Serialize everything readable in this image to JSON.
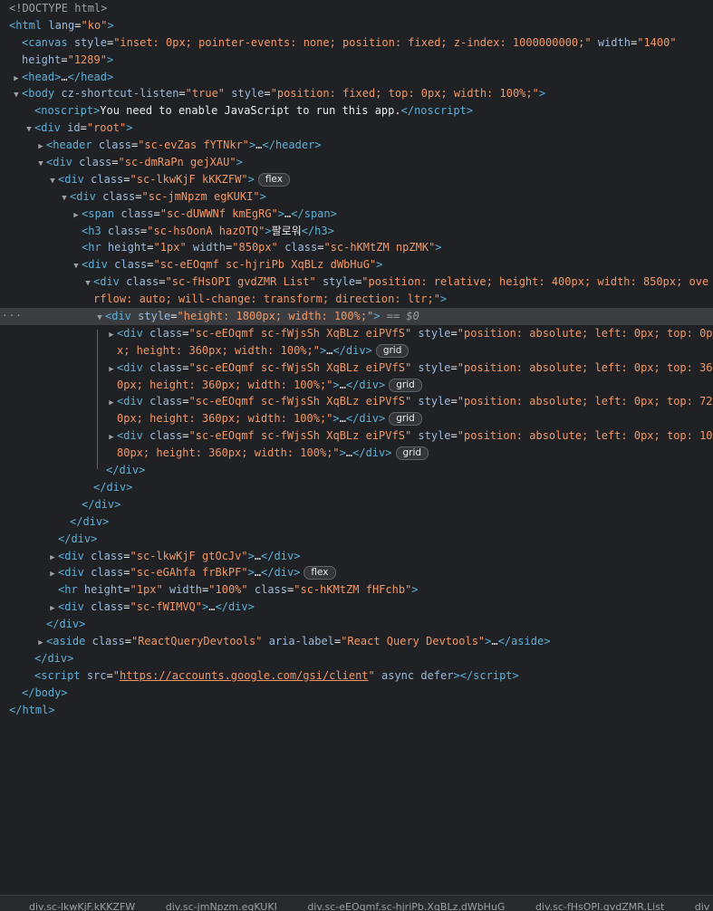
{
  "tree": {
    "l00": {
      "doctype": "<!DOCTYPE html>"
    },
    "l01": {
      "tag": "html",
      "attr": "lang",
      "val": "ko"
    },
    "l02": {
      "tag": "canvas",
      "a1": "style",
      "v1": "inset: 0px; pointer-events: none; position: fixed; z-index: 1000000000;",
      "a2": "width",
      "v2": "1400"
    },
    "l03": {
      "a1": "height",
      "v1": "1289"
    },
    "l04": {
      "tag": "head",
      "ell": "…"
    },
    "l05": {
      "tag": "body",
      "a1": "cz-shortcut-listen",
      "v1": "true",
      "a2": "style",
      "v2": "position: fixed; top: 0px; width: 100%;"
    },
    "l06": {
      "tag": "noscript",
      "text": "You need to enable JavaScript to run this app."
    },
    "l07": {
      "tag": "div",
      "a1": "id",
      "v1": "root"
    },
    "l08": {
      "tag": "header",
      "a1": "class",
      "v1": "sc-evZas fYTNkr",
      "ell": "…"
    },
    "l09": {
      "tag": "div",
      "a1": "class",
      "v1": "sc-dmRaPn gejXAU"
    },
    "l10": {
      "tag": "div",
      "a1": "class",
      "v1": "sc-lkwKjF kKKZFW",
      "badge": "flex"
    },
    "l11": {
      "tag": "div",
      "a1": "class",
      "v1": "sc-jmNpzm egKUKI"
    },
    "l12": {
      "tag": "span",
      "a1": "class",
      "v1": "sc-dUWWNf kmEgRG",
      "ell": "…"
    },
    "l13": {
      "tag": "h3",
      "a1": "class",
      "v1": "sc-hsOonA hazOTQ",
      "text": "팔로워"
    },
    "l14": {
      "tag": "hr",
      "a1": "height",
      "v1": "1px",
      "a2": "width",
      "v2": "850px",
      "a3": "class",
      "v3": "sc-hKMtZM npZMK"
    },
    "l15": {
      "tag": "div",
      "a1": "class",
      "v1": "sc-eEOqmf sc-hjriPb XqBLz dWbHuG"
    },
    "l16": {
      "tag": "div",
      "a1": "class",
      "v1": "sc-fHsOPI gvdZMR List",
      "a2": "style",
      "v2": "position: relative; height: 400px; width: 850px; ove"
    },
    "l17": {
      "v2": "rflow: auto; will-change: transform; direction: ltr;"
    },
    "l18": {
      "tag": "div",
      "a1": "style",
      "v1": "height: 1800px; width: 100%;",
      "marker": "== $0",
      "dots": "···"
    },
    "l19": {
      "tag": "div",
      "a1": "class",
      "v1": "sc-eEOqmf sc-fWjsSh XqBLz eiPVfS",
      "a2": "style",
      "v2": "position: absolute; left: 0px; top: 0p"
    },
    "l20": {
      "v2": "x; height: 360px; width: 100%;",
      "ell": "…",
      "badge": "grid"
    },
    "l21": {
      "tag": "div",
      "a1": "class",
      "v1": "sc-eEOqmf sc-fWjsSh XqBLz eiPVfS",
      "a2": "style",
      "v2": "position: absolute; left: 0px; top: 36"
    },
    "l22": {
      "v2": "0px; height: 360px; width: 100%;",
      "ell": "…",
      "badge": "grid"
    },
    "l23": {
      "tag": "div",
      "a1": "class",
      "v1": "sc-eEOqmf sc-fWjsSh XqBLz eiPVfS",
      "a2": "style",
      "v2": "position: absolute; left: 0px; top: 72"
    },
    "l24": {
      "v2": "0px; height: 360px; width: 100%;",
      "ell": "…",
      "badge": "grid"
    },
    "l25": {
      "tag": "div",
      "a1": "class",
      "v1": "sc-eEOqmf sc-fWjsSh XqBLz eiPVfS",
      "a2": "style",
      "v2": "position: absolute; left: 0px; top: 10"
    },
    "l26": {
      "v2": "80px; height: 360px; width: 100%;",
      "ell": "…",
      "badge": "grid"
    },
    "l27": {
      "close": "div"
    },
    "l28": {
      "close": "div"
    },
    "l29": {
      "close": "div"
    },
    "l30": {
      "close": "div"
    },
    "l31": {
      "close": "div"
    },
    "l32": {
      "tag": "div",
      "a1": "class",
      "v1": "sc-lkwKjF gtOcJv",
      "ell": "…"
    },
    "l33": {
      "tag": "div",
      "a1": "class",
      "v1": "sc-eGAhfa frBkPF",
      "ell": "…",
      "badge": "flex"
    },
    "l34": {
      "tag": "hr",
      "a1": "height",
      "v1": "1px",
      "a2": "width",
      "v2": "100%",
      "a3": "class",
      "v3": "sc-hKMtZM fHFchb"
    },
    "l35": {
      "tag": "div",
      "a1": "class",
      "v1": "sc-fWIMVQ",
      "ell": "…"
    },
    "l36": {
      "close": "div"
    },
    "l37": {
      "tag": "aside",
      "a1": "class",
      "v1": "ReactQueryDevtools",
      "a2": "aria-label",
      "v2": "React Query Devtools",
      "ell": "…"
    },
    "l38": {
      "close": "div"
    },
    "l39": {
      "tag": "script",
      "a1": "src",
      "v1": "https://accounts.google.com/gsi/client",
      "a2": "async defer"
    },
    "l40": {
      "close": "body"
    },
    "l41": {
      "close": "html"
    }
  },
  "breadcrumbs": [
    "div.sc-lkwKjF.kKKZFW",
    "div.sc-jmNpzm.egKUKI",
    "div.sc-eEOqmf.sc-hjriPb.XqBLz.dWbHuG",
    "div.sc-fHsOPI.gvdZMR.List",
    "div"
  ],
  "glyphs": {
    "expanded": "▼",
    "collapsed": "▶",
    "lt": "<",
    "gt": ">",
    "close_open": "</",
    "eq": "=",
    "q": "\""
  }
}
